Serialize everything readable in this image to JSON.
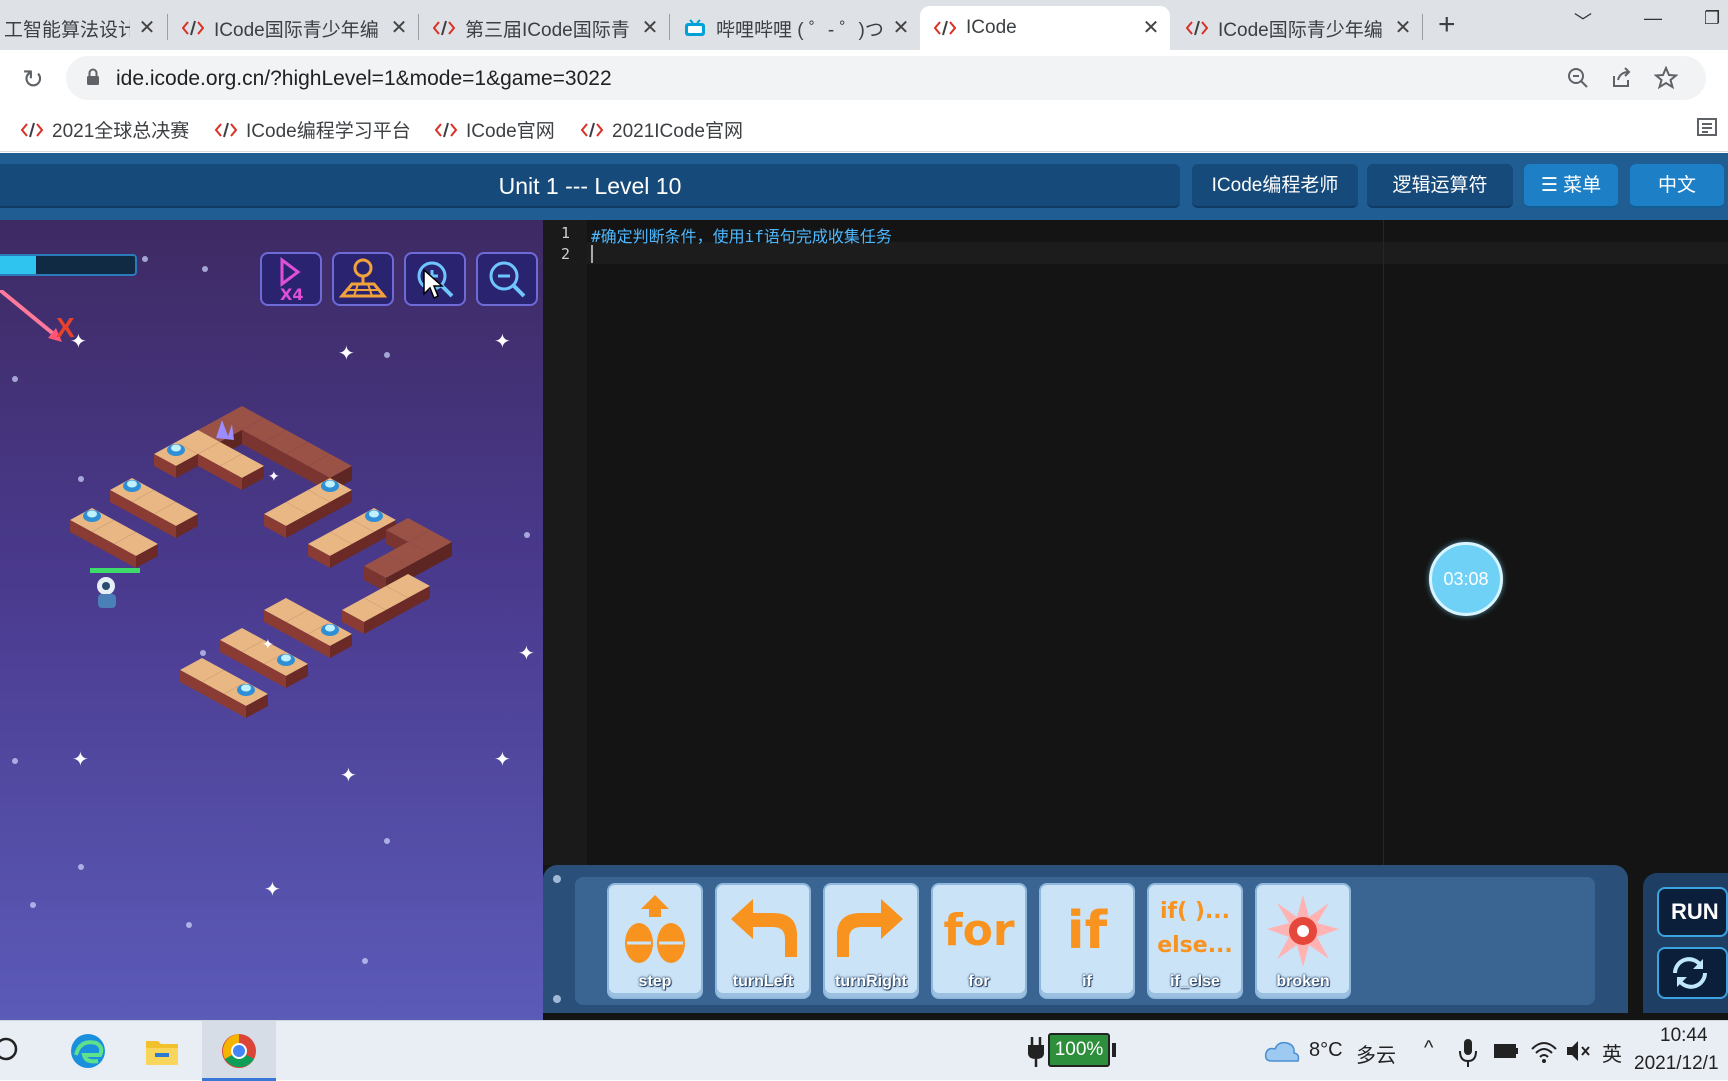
{
  "browser": {
    "tabs": [
      {
        "title": "工智能算法设计活"
      },
      {
        "title": "ICode国际青少年编"
      },
      {
        "title": "第三届ICode国际青"
      },
      {
        "title": "哔哩哔哩 ( ゜- ゜)つ"
      },
      {
        "title": "ICode"
      },
      {
        "title": "ICode国际青少年编"
      }
    ],
    "url": "ide.icode.org.cn/?highLevel=1&mode=1&game=3022",
    "bookmarks": [
      {
        "label": "2021全球总决赛"
      },
      {
        "label": "ICode编程学习平台"
      },
      {
        "label": "ICode官网"
      },
      {
        "label": "2021ICode官网"
      }
    ]
  },
  "header": {
    "level_title": "Unit 1 --- Level 10",
    "teacher_button": "ICode编程老师",
    "logic_button": "逻辑运算符",
    "menu_button": "☰ 菜单",
    "lang_button": "中文"
  },
  "game": {
    "health_fraction": 0.27,
    "axis_label": "X",
    "speed_label": "X4",
    "icons": [
      "speed-x4-icon",
      "map-locate-icon",
      "zoom-in-icon",
      "zoom-out-icon"
    ]
  },
  "editor": {
    "lines": [
      {
        "num": "1",
        "text": "#确定判断条件，使用if语句完成收集任务"
      },
      {
        "num": "2",
        "text": ""
      }
    ],
    "timer": "03:08"
  },
  "blocks": [
    {
      "label": "step",
      "icon": "step-feet-icon"
    },
    {
      "label": "turnLeft",
      "icon": "turn-left-arrow-icon"
    },
    {
      "label": "turnRight",
      "icon": "turn-right-arrow-icon"
    },
    {
      "label": "for",
      "icon_text": "for"
    },
    {
      "label": "if",
      "icon_text": "if"
    },
    {
      "label": "if_else",
      "icon_text_1": "if( )...",
      "icon_text_2": "else..."
    },
    {
      "label": "broken",
      "icon": "broken-burst-icon"
    }
  ],
  "run_button": "RUN",
  "taskbar": {
    "battery": "100%",
    "weather_temp": "8°C",
    "weather_desc": "多云",
    "ime": "英",
    "time": "10:44",
    "date": "2021/12/1"
  },
  "colors": {
    "header_bg": "#1f5d92",
    "accent_blue": "#1d80c7",
    "code_comment": "#4db8ff",
    "block_orange": "#f7931e",
    "timer_bg": "#6fd1f5"
  }
}
